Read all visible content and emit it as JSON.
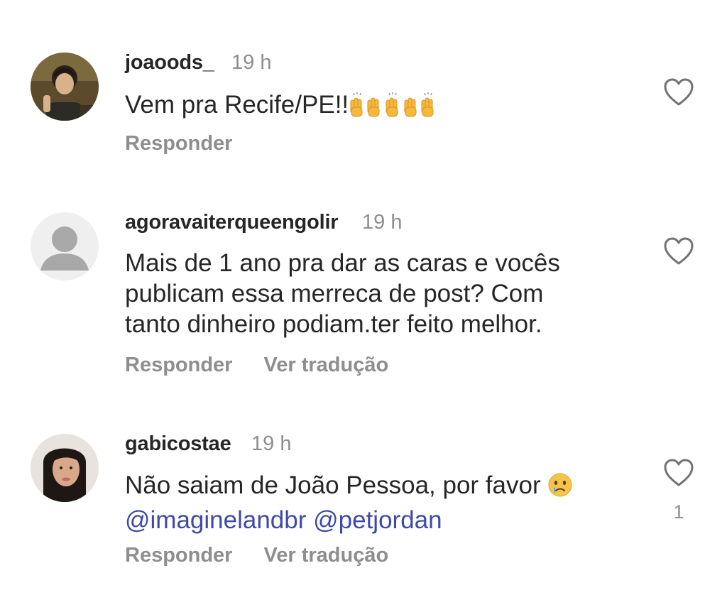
{
  "comments": [
    {
      "username": "joaoods_",
      "time": "19 h",
      "text": "Vem pra Recife/PE!!",
      "emojis": [
        "raising-hands",
        "raising-hands",
        "raising-hands",
        "raising-hands",
        "raising-hands"
      ],
      "reply_label": "Responder",
      "translate_label": "",
      "like_icon": "heart-outline-icon",
      "like_count": ""
    },
    {
      "username": "agoravaiterqueengolir",
      "time": "19 h",
      "text": "Mais de 1 ano pra dar as caras e vocês publicam essa merreca de post? Com tanto dinheiro podiam.ter feito melhor.",
      "reply_label": "Responder",
      "translate_label": "Ver tradução",
      "like_icon": "heart-outline-icon",
      "like_count": ""
    },
    {
      "username": "gabicostae",
      "time": "19 h",
      "text": "Não saiam de João Pessoa, por favor ",
      "emoji": "crying-face",
      "mention1": "@imaginelandbr",
      "mention2": "@petjordan",
      "reply_label": "Responder",
      "translate_label": "Ver tradução",
      "like_icon": "heart-outline-icon",
      "like_count": "1"
    }
  ],
  "colors": {
    "text": "#262626",
    "secondary": "#8e8e8e",
    "mention": "#3f4aa8"
  }
}
